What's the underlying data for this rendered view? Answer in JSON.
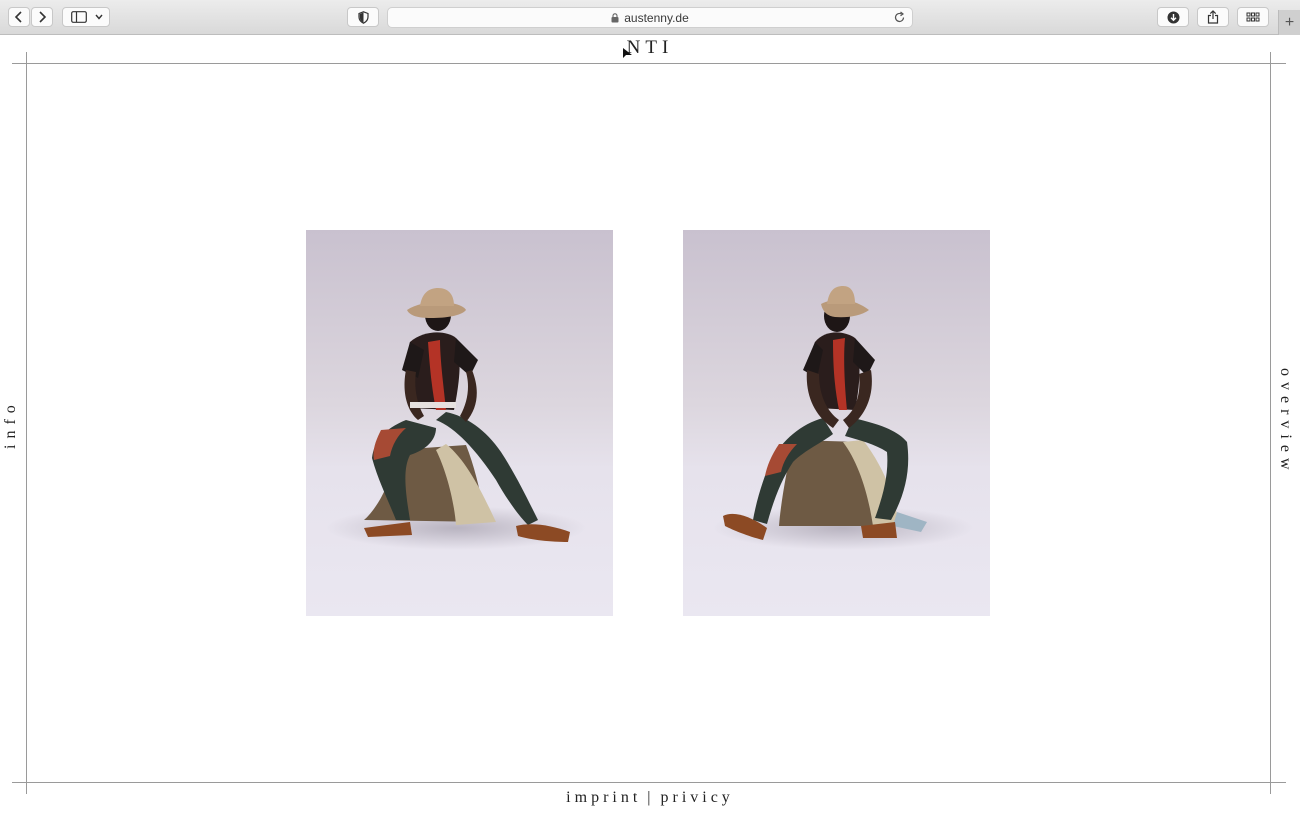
{
  "browser": {
    "url_domain": "austenny.de",
    "icons": {
      "back": "chevron-left-icon",
      "forward": "chevron-right-icon",
      "sidebar": "sidebar-icon",
      "shield": "privacy-shield-icon",
      "lock": "lock-icon",
      "reload": "reload-icon",
      "download": "download-icon",
      "share": "share-icon",
      "tabs": "tab-overview-icon",
      "new_tab": "plus-icon"
    },
    "new_tab_label": "+"
  },
  "site": {
    "brand": "NTI",
    "nav_left": "info",
    "nav_right": "overview",
    "footer": {
      "imprint": "imprint",
      "separator": "|",
      "privacy": "privicy"
    }
  },
  "gallery": {
    "images": [
      {
        "alt": "Model in cowboy hat seated on a draped stool, legs spread"
      },
      {
        "alt": "Model in cowboy hat seated on a draped stool, hands clasped"
      }
    ]
  },
  "colors": {
    "frame_line": "#9a9a9a",
    "text": "#222222",
    "photo_backdrop": "#dcd6de"
  }
}
